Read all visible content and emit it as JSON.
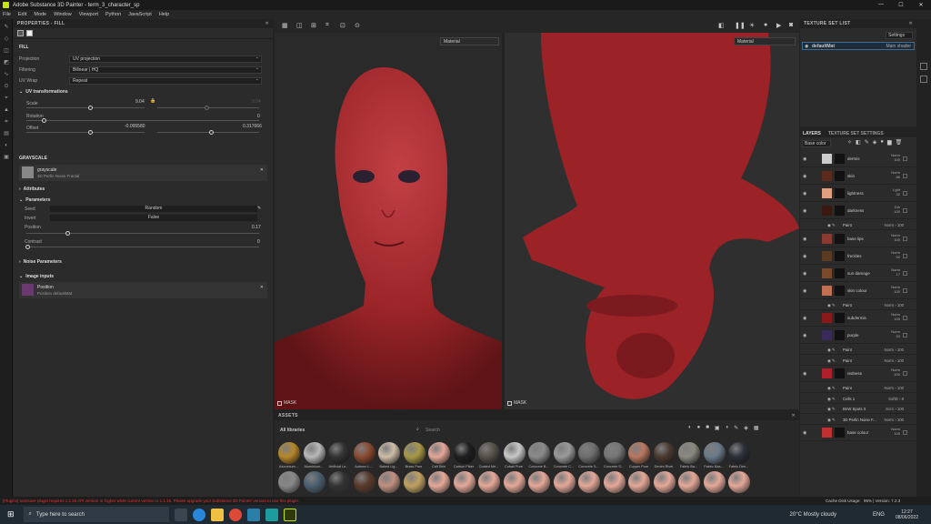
{
  "window": {
    "title": "Adobe Substance 3D Painter - term_3_character_sp",
    "min": "—",
    "max": "☐",
    "close": "✕"
  },
  "menu": [
    "File",
    "Edit",
    "Mode",
    "Window",
    "Viewport",
    "Python",
    "JavaScript",
    "Help"
  ],
  "properties": {
    "title": "PROPERTIES - FILL",
    "fill": "FILL",
    "projection": {
      "label": "Projection",
      "value": "UV projection"
    },
    "filtering": {
      "label": "Filtering",
      "value": "Bilinear | HQ"
    },
    "uvwrap": {
      "label": "UV Wrap",
      "value": "Repeat"
    },
    "uvtrans": "UV transformations",
    "scale": {
      "label": "Scale",
      "value": "9.04",
      "value2": "9.04"
    },
    "rotation": {
      "label": "Rotation",
      "value": "0"
    },
    "offset": {
      "label": "Offset",
      "v1": "-0.095580",
      "v2": "0.317666"
    },
    "grayscale": "GRAYSCALE",
    "gs_item": {
      "name": "grayscale",
      "sub": "3D Perlin Noise Fractal"
    },
    "attributes": "Attributes",
    "parameters": "Parameters",
    "seed": {
      "label": "Seed",
      "value": "Random"
    },
    "invert": {
      "label": "Invert",
      "value": "False"
    },
    "position": {
      "label": "Position",
      "value": "0.17"
    },
    "contrast": {
      "label": "Contrast",
      "value": "0"
    },
    "noise_params": "Noise Parameters",
    "image_inputs": "Image inputs",
    "pos_input": {
      "name": "Position",
      "sub": "Position defaultMat"
    }
  },
  "viewport": {
    "material1": "Material",
    "material2": "Material",
    "mask1": "MASK",
    "mask2": "MASK"
  },
  "assets": {
    "title": "ASSETS",
    "library": "All libraries",
    "search": "Search",
    "row1": [
      "Aluminium...",
      "Aluminium...",
      "Artificial Le...",
      "Autumn L...",
      "Baked Lig...",
      "Brass Pure",
      "Calf Skin",
      "Carbon Fiber",
      "Coated Me...",
      "Cobalt Pure",
      "Concrete B...",
      "Concrete C...",
      "Concrete S...",
      "Concrete S...",
      "Copper Pure",
      "Denim Rivet",
      "Fabric Ba...",
      "Fabric Bas...",
      "Fabric Den..."
    ]
  },
  "texture_set": {
    "title": "TEXTURE SET LIST",
    "settings": "Settings",
    "item": "defaultMat",
    "shader": "Main shader"
  },
  "layers_panel": {
    "tab1": "LAYERS",
    "tab2": "TEXTURE SET SETTINGS",
    "channel": "Base color",
    "rows": [
      {
        "name": "dermis",
        "b1": "Norm",
        "b2": "100"
      },
      {
        "name": "skin",
        "b1": "Norm",
        "b2": "86"
      },
      {
        "name": "lightness",
        "b1": "Lght",
        "b2": "32"
      },
      {
        "name": "darkness",
        "b1": "Drk",
        "b2": "100"
      },
      {
        "name": "Paint",
        "b1": "Norm",
        "b2": "100"
      },
      {
        "name": "base lips",
        "b1": "Norm",
        "b2": "100"
      },
      {
        "name": "freckles",
        "b1": "Norm",
        "b2": "92"
      },
      {
        "name": "sun damage",
        "b1": "Norm",
        "b2": "17"
      },
      {
        "name": "skin colour",
        "b1": "Norm",
        "b2": "100"
      },
      {
        "name": "Paint",
        "b1": "Norm",
        "b2": "100"
      },
      {
        "name": "subdermis",
        "b1": "Norm",
        "b2": "100"
      },
      {
        "name": "purple",
        "b1": "Norm",
        "b2": "93"
      },
      {
        "name": "Paint",
        "b1": "Norm",
        "b2": "100"
      },
      {
        "name": "Paint",
        "b1": "Norm",
        "b2": "100"
      },
      {
        "name": "redness",
        "b1": "Norm",
        "b2": "100"
      },
      {
        "name": "Paint",
        "b1": "Norm",
        "b2": "100"
      },
      {
        "name": "Cells 1",
        "b1": "SoftD",
        "b2": "8"
      },
      {
        "name": "BnW Spots 3",
        "b1": "Scrn",
        "b2": "100"
      },
      {
        "name": "3D Perlin Noise F...",
        "b1": "Norm",
        "b2": "100"
      },
      {
        "name": "base colour",
        "b1": "Norm",
        "b2": "100"
      }
    ]
  },
  "status": {
    "warning": "[Plugins] autosave plugin requires 1.1.25 API version or higher while current version is 1.1.16. Please upgrade your Substance 3D Painter version to use this plugin.",
    "cache": "Cache Disk Usage:",
    "usage": "95% | Version: 7.2.3"
  },
  "taskbar": {
    "search": "Type here to search",
    "weather": "20°C  Mostly cloudy",
    "lang": "ENG",
    "time": "12:27",
    "date": "08/06/2022"
  }
}
